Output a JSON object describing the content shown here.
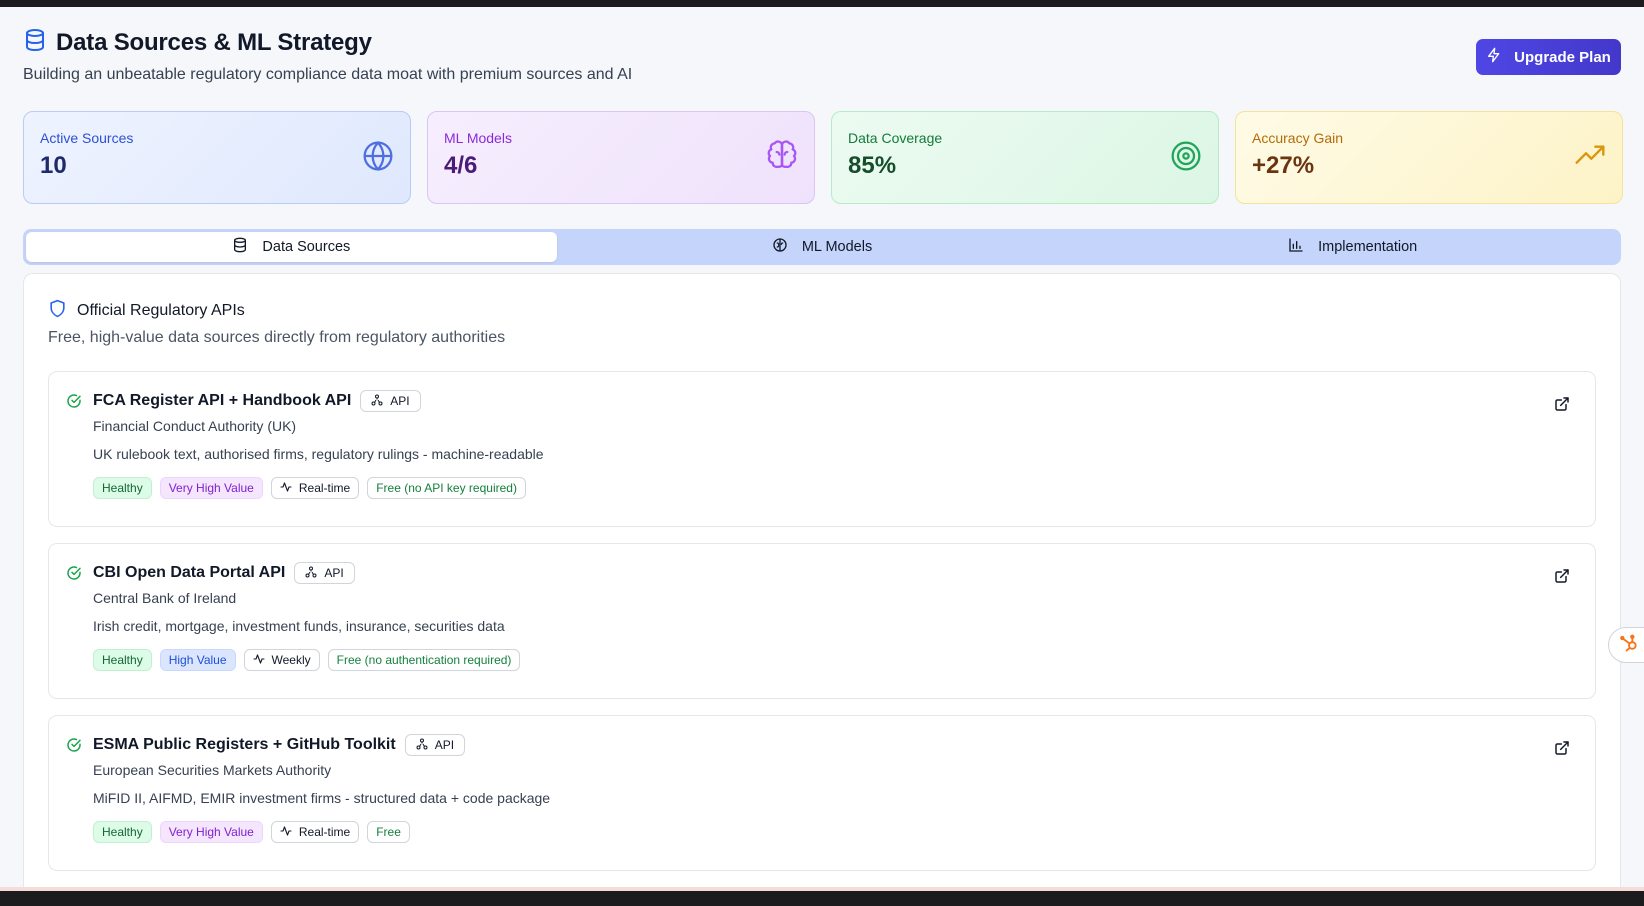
{
  "header": {
    "title": "Data Sources & ML Strategy",
    "subtitle": "Building an unbeatable regulatory compliance data moat with premium sources and AI",
    "icon": "database-icon",
    "upgrade_label": "Upgrade Plan"
  },
  "stats": [
    {
      "label": "Active Sources",
      "value": "10",
      "icon": "globe-icon",
      "color": "#2d4fd6"
    },
    {
      "label": "ML Models",
      "value": "4/6",
      "icon": "brain-icon",
      "color": "#8a2bd8"
    },
    {
      "label": "Data Coverage",
      "value": "85%",
      "icon": "target-icon",
      "color": "#157a3a"
    },
    {
      "label": "Accuracy Gain",
      "value": "+27%",
      "icon": "trending-up-icon",
      "color": "#b36b0a"
    }
  ],
  "tabs": [
    {
      "label": "Data Sources",
      "icon": "database-icon",
      "active": true
    },
    {
      "label": "ML Models",
      "icon": "brain-icon",
      "active": false
    },
    {
      "label": "Implementation",
      "icon": "bar-chart-icon",
      "active": false
    }
  ],
  "section": {
    "title": "Official Regulatory APIs",
    "description": "Free, high-value data sources directly from regulatory authorities",
    "icon": "shield-icon"
  },
  "sources": [
    {
      "name": "FCA Register API + Handbook API",
      "type": "API",
      "org": "Financial Conduct Authority (UK)",
      "description": "UK rulebook text, authorised firms, regulatory rulings - machine-readable",
      "health": "Healthy",
      "value": "Very High Value",
      "frequency": "Real-time",
      "cost": "Free (no API key required)"
    },
    {
      "name": "CBI Open Data Portal API",
      "type": "API",
      "org": "Central Bank of Ireland",
      "description": "Irish credit, mortgage, investment funds, insurance, securities data",
      "health": "Healthy",
      "value": "High Value",
      "frequency": "Weekly",
      "cost": "Free (no authentication required)"
    },
    {
      "name": "ESMA Public Registers + GitHub Toolkit",
      "type": "API",
      "org": "European Securities Markets Authority",
      "description": "MiFID II, AIFMD, EMIR investment firms - structured data + code package",
      "health": "Healthy",
      "value": "Very High Value",
      "frequency": "Real-time",
      "cost": "Free"
    }
  ],
  "colors": {
    "accent": "#4338ca",
    "healthy": "#166534",
    "very_high_value": "#7e22ce",
    "high_value": "#1d4ed8"
  }
}
